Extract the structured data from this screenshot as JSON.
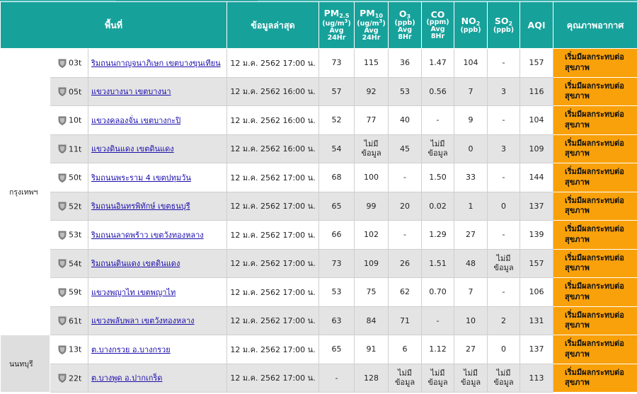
{
  "headers": {
    "area": "พื้นที่",
    "latest": "ข้อมูลล่าสุด",
    "pm25": {
      "name": "PM",
      "sub": "2.5",
      "unit": "(ug/m",
      "unit_sup": "3",
      "unit_end": ")",
      "avg1": "Avg",
      "avg2": "24Hr"
    },
    "pm10": {
      "name": "PM",
      "sub": "10",
      "unit": "(ug/m",
      "unit_sup": "3",
      "unit_end": ")",
      "avg1": "Avg",
      "avg2": "24Hr"
    },
    "o3": {
      "name": "O",
      "sub": "3",
      "unit": "(ppb)",
      "avg1": "Avg",
      "avg2": "8Hr"
    },
    "co": {
      "name": "CO",
      "unit": "(ppm)",
      "avg1": "Avg",
      "avg2": "8Hr"
    },
    "no2": {
      "name": "NO",
      "sub": "2",
      "unit": "(ppb)"
    },
    "so2": {
      "name": "SO",
      "sub": "2",
      "unit": "(ppb)"
    },
    "aqi": "AQI",
    "quality": "คุณภาพอากาศ"
  },
  "na_line1": "ไม่มี",
  "na_line2": "ข้อมูล",
  "colors": {
    "header": "#17a19b",
    "quality": "#f9a10a",
    "row_alt": "#e4e4e4"
  },
  "areas": [
    {
      "label": "กรุงเทพฯ",
      "rows": 10
    },
    {
      "label": "นนทบุรี",
      "rows": 2
    }
  ],
  "rows": [
    {
      "id": "03t",
      "name": "ริมถนนกาญจนาภิเษก เขตบางขุนเทียน",
      "time": "12 ม.ค. 2562 17:00 น.",
      "pm25": "73",
      "pm10": "115",
      "o3": "36",
      "co": "1.47",
      "no2": "104",
      "so2": "-",
      "aqi": "157",
      "q1": "เริ่มมีผลกระทบต่อ",
      "q2": "สุขภาพ"
    },
    {
      "id": "05t",
      "name": "แขวงบางนา เขตบางนา",
      "time": "12 ม.ค. 2562 16:00 น.",
      "pm25": "57",
      "pm10": "92",
      "o3": "53",
      "co": "0.56",
      "no2": "7",
      "so2": "3",
      "aqi": "116",
      "q1": "เริ่มมีผลกระทบต่อ",
      "q2": "สุขภาพ"
    },
    {
      "id": "10t",
      "name": "แขวงคลองจั่น เขตบางกะปิ",
      "time": "12 ม.ค. 2562 16:00 น.",
      "pm25": "52",
      "pm10": "77",
      "o3": "40",
      "co": "-",
      "no2": "9",
      "so2": "-",
      "aqi": "104",
      "q1": "เริ่มมีผลกระทบต่อ",
      "q2": "สุขภาพ"
    },
    {
      "id": "11t",
      "name": "แขวงดินแดง เขตดินแดง",
      "time": "12 ม.ค. 2562 16:00 น.",
      "pm25": "54",
      "pm10": "NA",
      "o3": "45",
      "co": "NA",
      "no2": "0",
      "so2": "3",
      "aqi": "109",
      "q1": "เริ่มมีผลกระทบต่อ",
      "q2": "สุขภาพ"
    },
    {
      "id": "50t",
      "name": "ริมถนนพระราม 4 เขตปทุมวัน",
      "time": "12 ม.ค. 2562 17:00 น.",
      "pm25": "68",
      "pm10": "100",
      "o3": "-",
      "co": "1.50",
      "no2": "33",
      "so2": "-",
      "aqi": "144",
      "q1": "เริ่มมีผลกระทบต่อ",
      "q2": "สุขภาพ"
    },
    {
      "id": "52t",
      "name": "ริมถนนอินทรพิทักษ์ เขตธนบุรี",
      "time": "12 ม.ค. 2562 17:00 น.",
      "pm25": "65",
      "pm10": "99",
      "o3": "20",
      "co": "0.02",
      "no2": "1",
      "so2": "0",
      "aqi": "137",
      "q1": "เริ่มมีผลกระทบต่อ",
      "q2": "สุขภาพ"
    },
    {
      "id": "53t",
      "name": "ริมถนนลาดพร้าว เขตวังทองหลาง",
      "time": "12 ม.ค. 2562 17:00 น.",
      "pm25": "66",
      "pm10": "102",
      "o3": "-",
      "co": "1.29",
      "no2": "27",
      "so2": "-",
      "aqi": "139",
      "q1": "เริ่มมีผลกระทบต่อ",
      "q2": "สุขภาพ"
    },
    {
      "id": "54t",
      "name": "ริมถนนดินแดง เขตดินแดง",
      "time": "12 ม.ค. 2562 17:00 น.",
      "pm25": "73",
      "pm10": "109",
      "o3": "26",
      "co": "1.51",
      "no2": "48",
      "so2": "NA",
      "aqi": "157",
      "q1": "เริ่มมีผลกระทบต่อ",
      "q2": "สุขภาพ"
    },
    {
      "id": "59t",
      "name": "แขวงพญาไท เขตพญาไท",
      "time": "12 ม.ค. 2562 17:00 น.",
      "pm25": "53",
      "pm10": "75",
      "o3": "62",
      "co": "0.70",
      "no2": "7",
      "so2": "-",
      "aqi": "106",
      "q1": "เริ่มมีผลกระทบต่อ",
      "q2": "สุขภาพ"
    },
    {
      "id": "61t",
      "name": "แขวงพลับพลา เขตวังทองหลาง",
      "time": "12 ม.ค. 2562 17:00 น.",
      "pm25": "63",
      "pm10": "84",
      "o3": "71",
      "co": "-",
      "no2": "10",
      "so2": "2",
      "aqi": "131",
      "q1": "เริ่มมีผลกระทบต่อ",
      "q2": "สุขภาพ"
    },
    {
      "id": "13t",
      "name": "ต.บางกรวย อ.บางกรวย",
      "time": "12 ม.ค. 2562 17:00 น.",
      "pm25": "65",
      "pm10": "91",
      "o3": "6",
      "co": "1.12",
      "no2": "27",
      "so2": "0",
      "aqi": "137",
      "q1": "เริ่มมีผลกระทบต่อ",
      "q2": "สุขภาพ"
    },
    {
      "id": "22t",
      "name": "ต.บางพูด อ.ปากเกร็ด",
      "time": "12 ม.ค. 2562 17:00 น.",
      "pm25": "-",
      "pm10": "128",
      "o3": "NA",
      "co": "NA",
      "no2": "NA",
      "so2": "NA",
      "aqi": "113",
      "q1": "เริ่มมีผลกระทบต่อ",
      "q2": "สุขภาพ"
    }
  ]
}
